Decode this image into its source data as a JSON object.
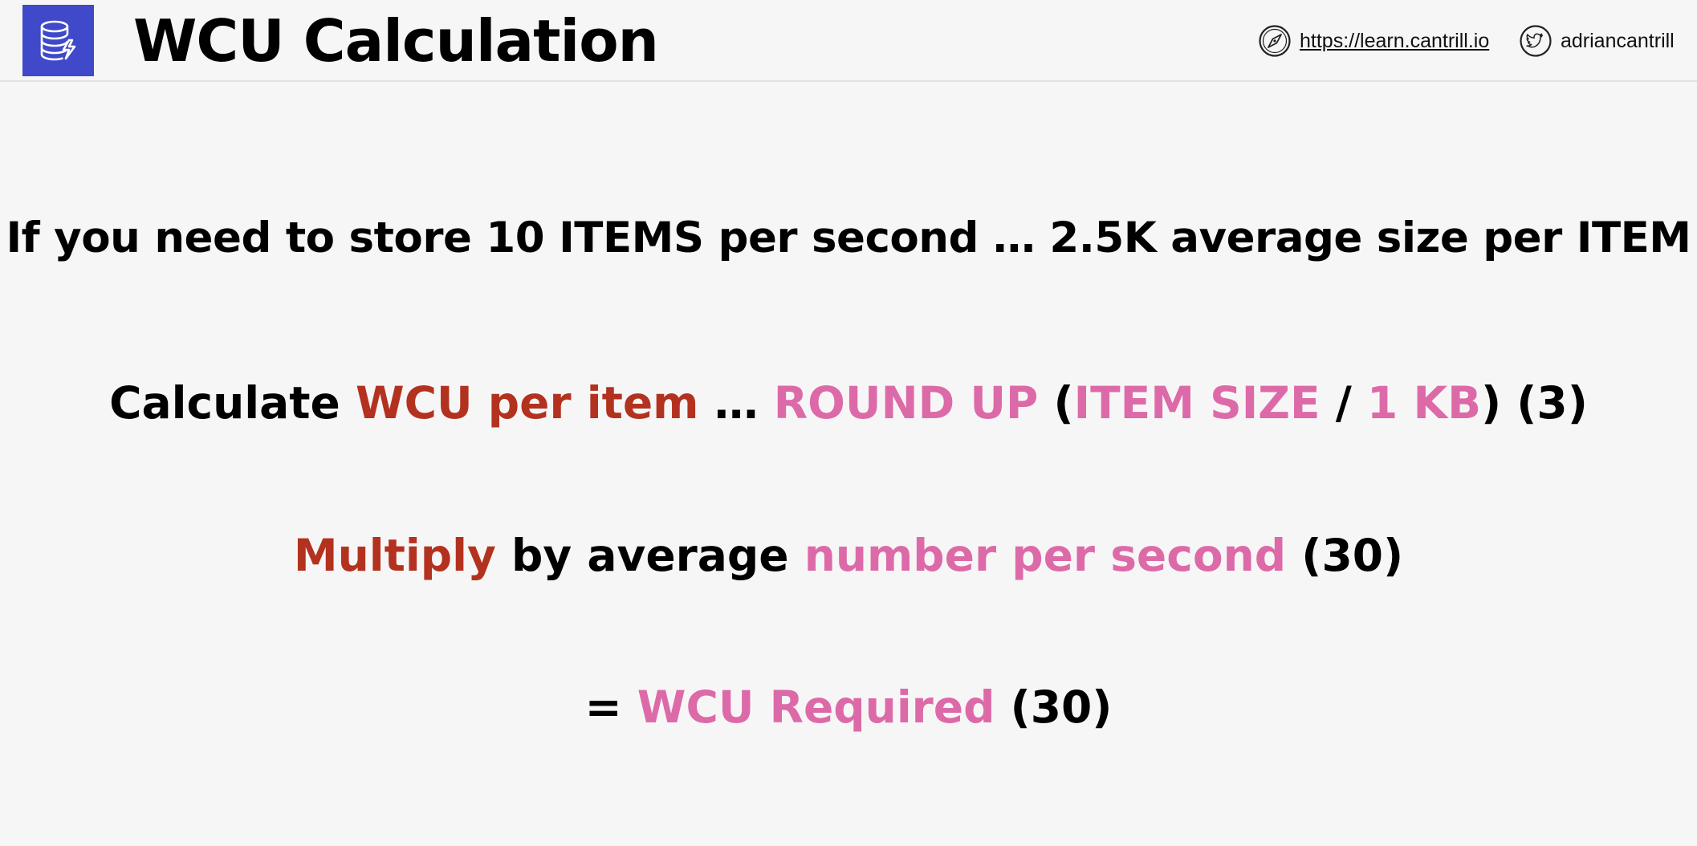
{
  "header": {
    "title": "WCU Calculation",
    "logo_icon": "dynamodb-icon",
    "website_icon": "compass-icon",
    "website_link": "https://learn.cantrill.io",
    "twitter_icon": "twitter-icon",
    "twitter_handle": "adriancantrill"
  },
  "colors": {
    "background": "#f7f6f6",
    "logo_bg": "#3f49c9",
    "red": "#b3321f",
    "pink": "#dd6aa8",
    "text": "#000000"
  },
  "content": {
    "line1": "If you need to store 10 ITEMS per second … 2.5K average size per ITEM",
    "line2": {
      "part1": "Calculate ",
      "part2": "WCU per item",
      "part3": " …  ",
      "part4": "ROUND UP",
      "part5": " (",
      "part6": "ITEM SIZE",
      "part7": " / ",
      "part8": "1 KB",
      "part9": ") (3)"
    },
    "line3": {
      "part1": "Multiply",
      "part2": " by average ",
      "part3": "number per second",
      "part4": " (30)"
    },
    "line4": {
      "part1": "= ",
      "part2": "WCU Required",
      "part3": " (30)"
    }
  }
}
